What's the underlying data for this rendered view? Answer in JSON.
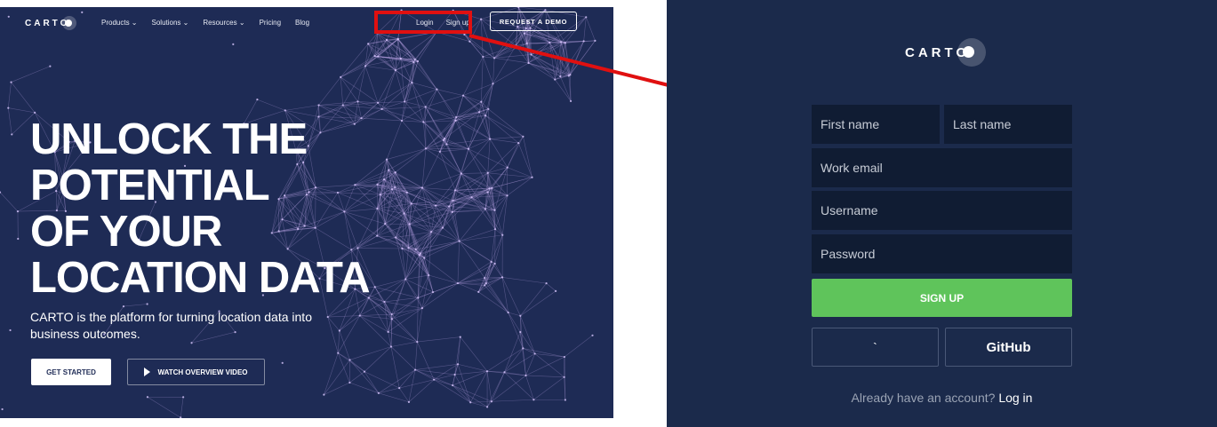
{
  "landing": {
    "logo": "CARTO",
    "nav": [
      "Products",
      "Solutions",
      "Resources",
      "Pricing",
      "Blog"
    ],
    "login": "Login",
    "signup": "Sign up",
    "demo": "REQUEST A DEMO",
    "hero_lines": [
      "UNLOCK THE",
      "POTENTIAL",
      "OF YOUR",
      "LOCATION DATA"
    ],
    "subtitle": "CARTO is the platform for turning location data into business outcomes.",
    "get_started": "GET STARTED",
    "watch_video": "WATCH OVERVIEW VIDEO"
  },
  "signup": {
    "logo": "CARTO",
    "first_name": "First name",
    "last_name": "Last name",
    "work_email": "Work email",
    "username": "Username",
    "password": "Password",
    "sign_up_button": "SIGN UP",
    "oauth_left": "`",
    "oauth_right": "GitHub",
    "already_text": "Already have an account? ",
    "login_link": "Log in"
  },
  "colors": {
    "landing_bg": "#1e2b55",
    "panel_bg": "#1b2a4b",
    "field_bg": "#101c33",
    "signup_green": "#5fc45b",
    "highlight_red": "#e01010"
  }
}
